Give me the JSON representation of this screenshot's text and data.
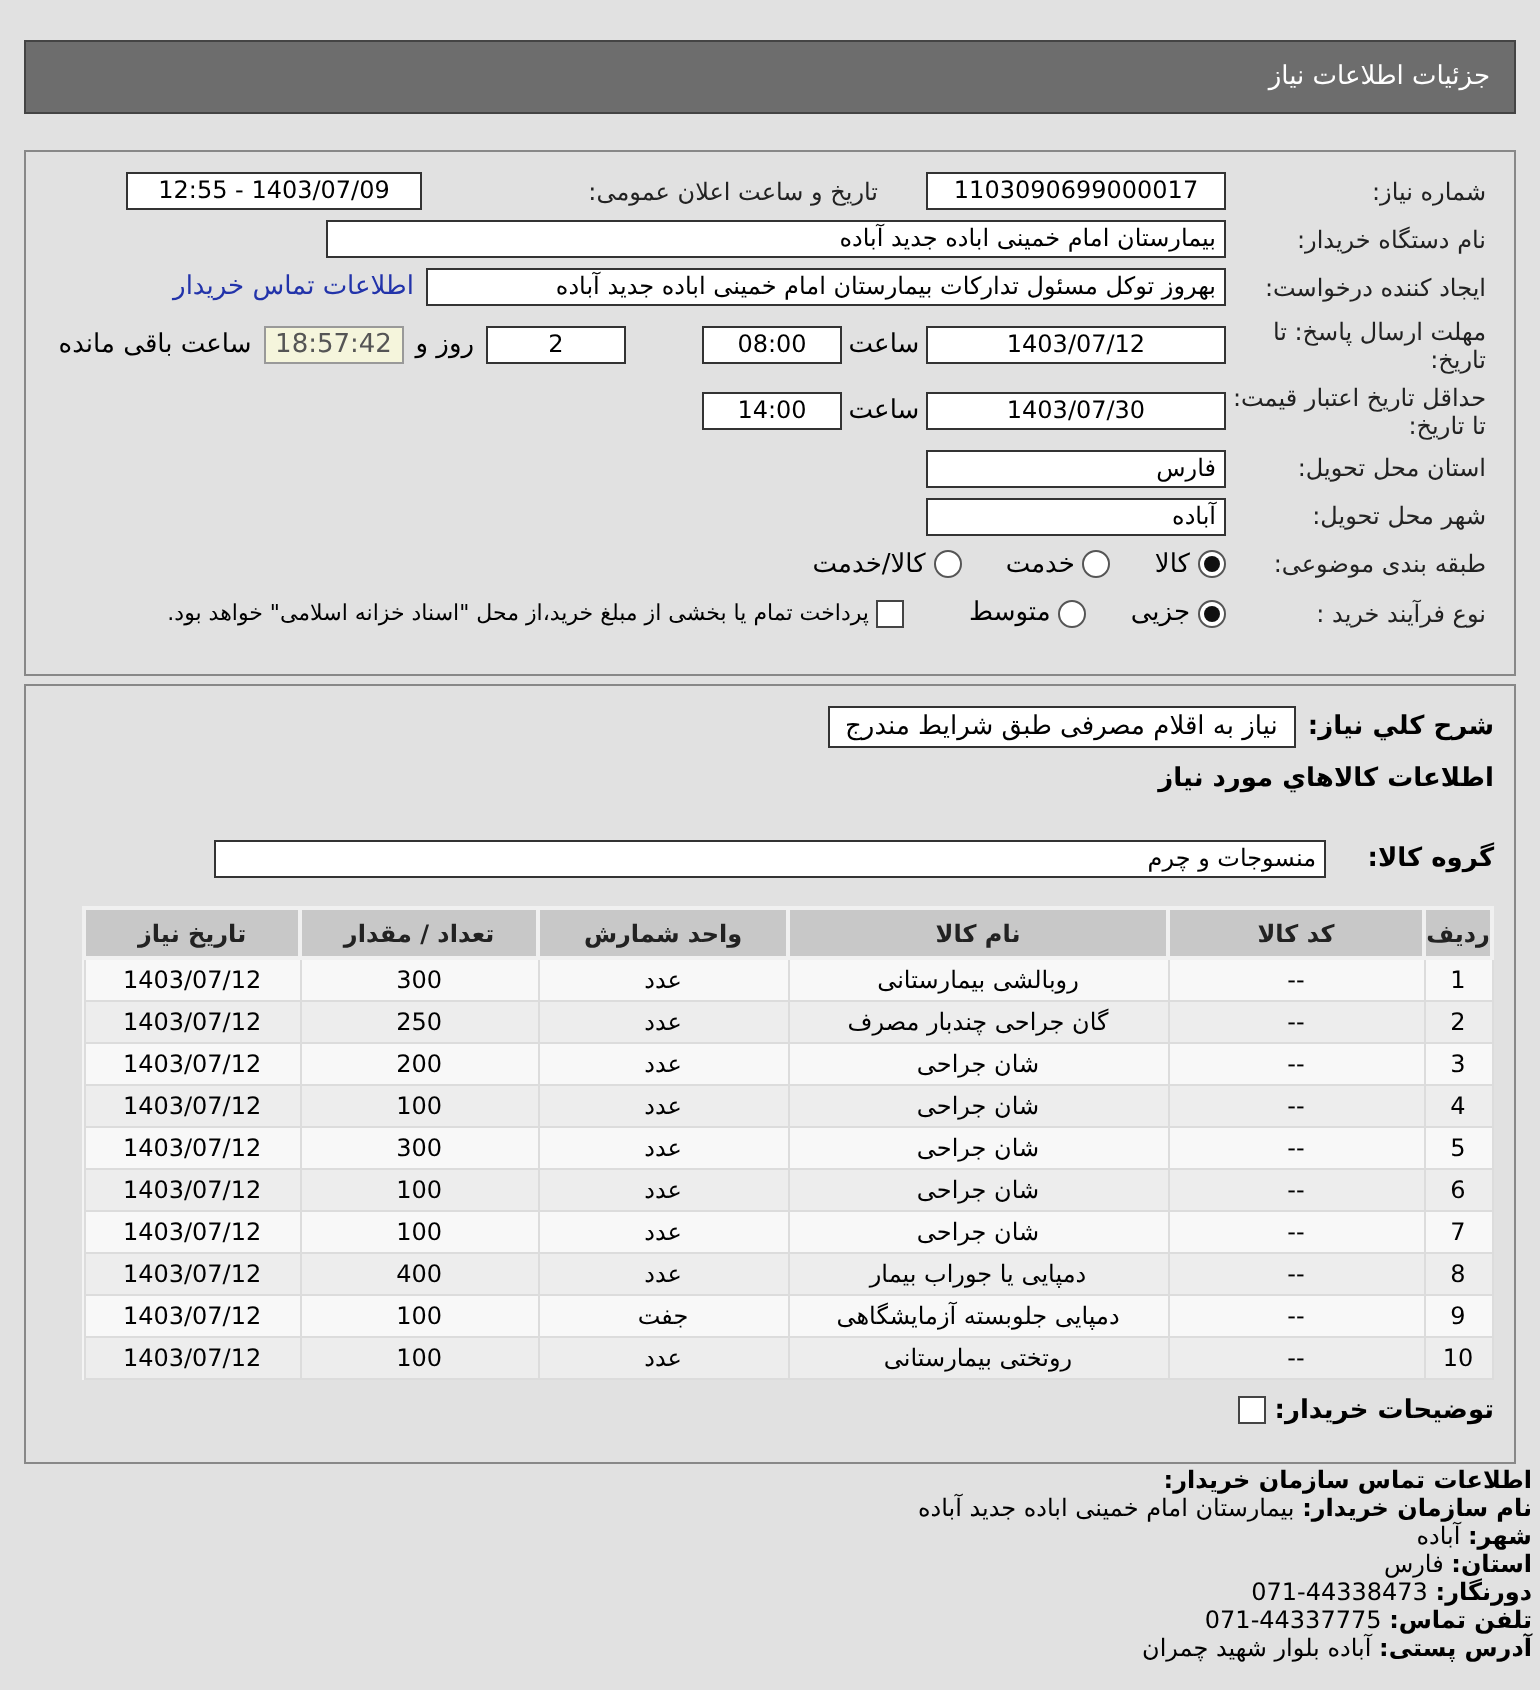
{
  "header": {
    "title": "جزئیات اطلاعات نیاز"
  },
  "form": {
    "need_number": {
      "label": "شماره نیاز:",
      "value": "1103090699000017"
    },
    "announce": {
      "label": "تاریخ و ساعت اعلان عمومی:",
      "value": "1403/07/09 - 12:55"
    },
    "buyer": {
      "label": "نام دستگاه خریدار:",
      "value": "بیمارستان امام خمینی اباده جدید آباده"
    },
    "creator": {
      "label": "ایجاد کننده درخواست:",
      "value": "بهروز توکل مسئول تدارکات بیمارستان امام خمینی اباده جدید آباده",
      "link": "اطلاعات تماس خریدار"
    },
    "deadline": {
      "label": "مهلت ارسال پاسخ: تا تاریخ:",
      "date": "1403/07/12",
      "time_label": "ساعت",
      "time": "08:00",
      "days": "2",
      "days_label": "روز و",
      "remaining": "18:57:42",
      "remaining_label": "ساعت باقی مانده"
    },
    "validity": {
      "label": "حداقل تاریخ اعتبار قیمت: تا تاریخ:",
      "date": "1403/07/30",
      "time_label": "ساعت",
      "time": "14:00"
    },
    "province": {
      "label": "استان محل تحویل:",
      "value": "فارس"
    },
    "city": {
      "label": "شهر محل تحویل:",
      "value": "آباده"
    },
    "category": {
      "label": "طبقه بندی موضوعی:",
      "options": [
        {
          "label": "کالا",
          "selected": true
        },
        {
          "label": "خدمت",
          "selected": false
        },
        {
          "label": "کالا/خدمت",
          "selected": false
        }
      ]
    },
    "process": {
      "label": "نوع فرآیند خرید :",
      "options": [
        {
          "label": "جزیی",
          "selected": true
        },
        {
          "label": "متوسط",
          "selected": false
        }
      ],
      "payment": {
        "label": "پرداخت تمام یا بخشی از مبلغ خرید،از محل \"اسناد خزانه اسلامی\" خواهد بود.",
        "checked": false
      }
    }
  },
  "details": {
    "description_label": "شرح کلي نياز:",
    "description": "نیاز به اقلام مصرفی طبق شرایط مندرج",
    "items_title": "اطلاعات کالاهاي مورد نياز",
    "group_label": "گروه کالا:",
    "group": "منسوجات و چرم",
    "table": {
      "columns": [
        "ردیف",
        "کد کالا",
        "نام کالا",
        "واحد شمارش",
        "تعداد / مقدار",
        "تاریخ نیاز"
      ],
      "rows": [
        [
          "1",
          "--",
          "روبالشی بیمارستانی",
          "عدد",
          "300",
          "1403/07/12"
        ],
        [
          "2",
          "--",
          "گان جراحی چندبار مصرف",
          "عدد",
          "250",
          "1403/07/12"
        ],
        [
          "3",
          "--",
          "شان جراحی",
          "عدد",
          "200",
          "1403/07/12"
        ],
        [
          "4",
          "--",
          "شان جراحی",
          "عدد",
          "100",
          "1403/07/12"
        ],
        [
          "5",
          "--",
          "شان جراحی",
          "عدد",
          "300",
          "1403/07/12"
        ],
        [
          "6",
          "--",
          "شان جراحی",
          "عدد",
          "100",
          "1403/07/12"
        ],
        [
          "7",
          "--",
          "شان جراحی",
          "عدد",
          "100",
          "1403/07/12"
        ],
        [
          "8",
          "--",
          "دمپایی یا جوراب بیمار",
          "عدد",
          "400",
          "1403/07/12"
        ],
        [
          "9",
          "--",
          "دمپایی جلوبسته آزمایشگاهی",
          "جفت",
          "100",
          "1403/07/12"
        ],
        [
          "10",
          "--",
          "روتختی بیمارستانی",
          "عدد",
          "100",
          "1403/07/12"
        ]
      ]
    },
    "buyer_notes": {
      "label": "توضیحات خریدار:",
      "checked": false
    }
  },
  "contact": {
    "title": "اطلاعات تماس سازمان خریدار:",
    "lines": [
      {
        "label": "نام سازمان خریدار:",
        "value": "بیمارستان امام خمینی اباده جدید آباده"
      },
      {
        "label": "شهر:",
        "value": "آباده"
      },
      {
        "label": "استان:",
        "value": "فارس"
      },
      {
        "label": "دورنگار:",
        "value": "44338473-071"
      },
      {
        "label": "تلفن تماس:",
        "value": "44337775-071"
      },
      {
        "label": "آدرس پستی:",
        "value": "آباده بلوار شهید چمران"
      }
    ]
  }
}
